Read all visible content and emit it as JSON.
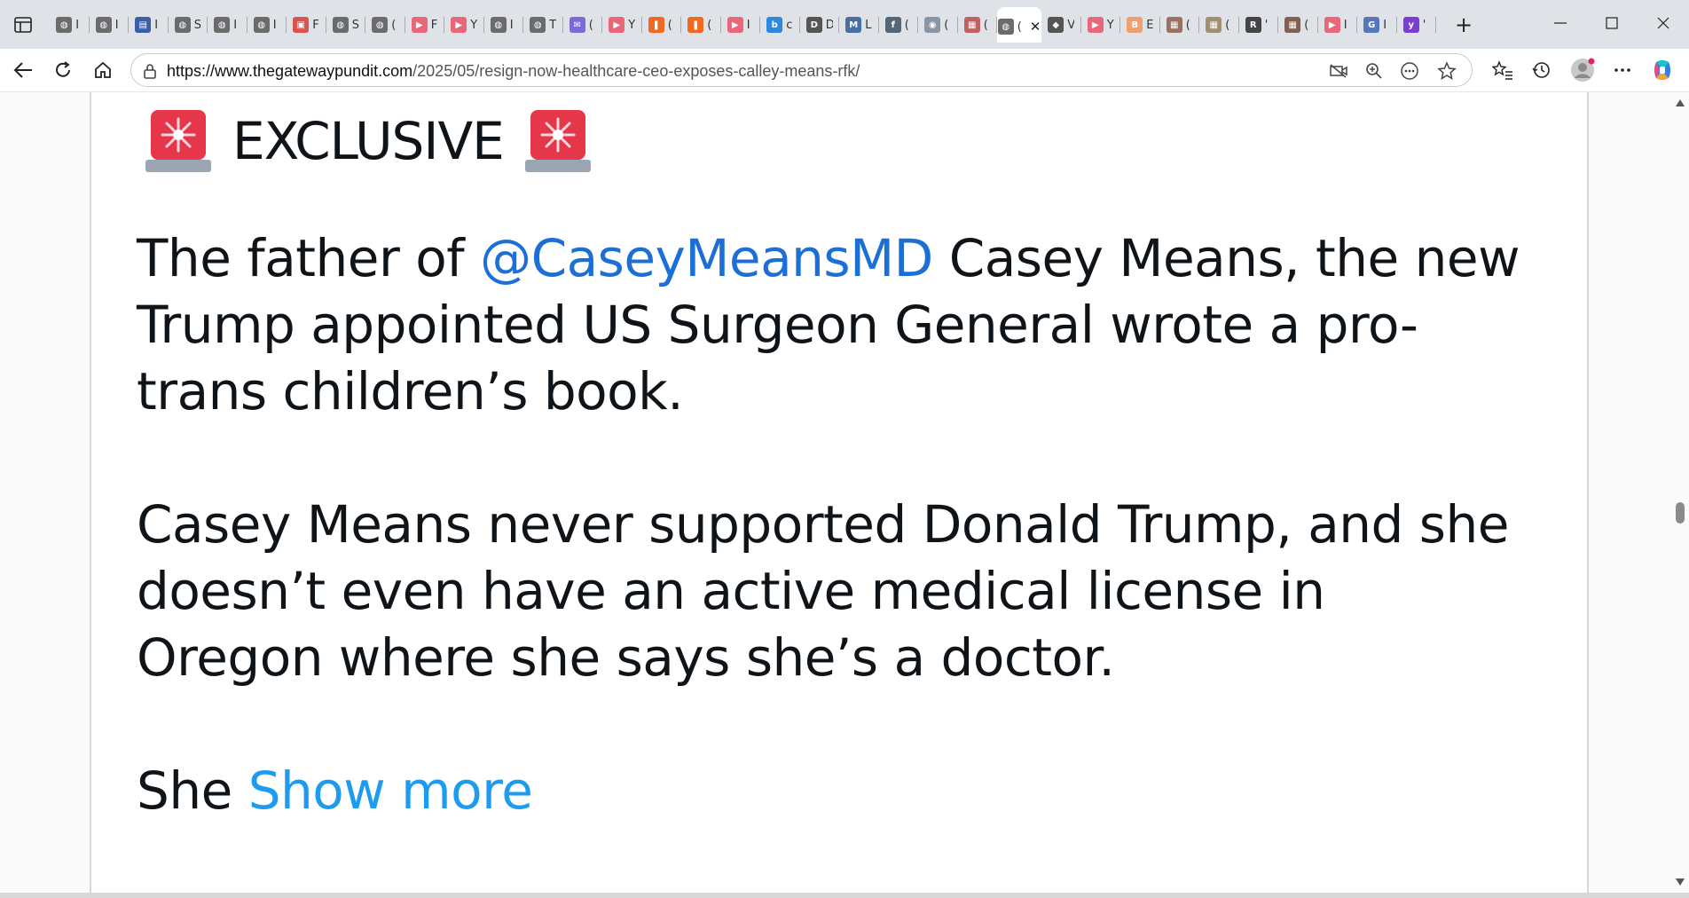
{
  "browser": {
    "tabs": [
      {
        "icon": "globe-icon",
        "color": "#6b6b6b",
        "glyph": "◍",
        "frag": "I"
      },
      {
        "icon": "globe-icon",
        "color": "#6b6b6b",
        "glyph": "◍",
        "frag": "I"
      },
      {
        "icon": "news-icon",
        "color": "#3a5fa8",
        "glyph": "▤",
        "frag": "I"
      },
      {
        "icon": "globe-icon",
        "color": "#6b6b6b",
        "glyph": "◍",
        "frag": "S"
      },
      {
        "icon": "globe-icon",
        "color": "#6b6b6b",
        "glyph": "◍",
        "frag": "I"
      },
      {
        "icon": "globe-icon",
        "color": "#6b6b6b",
        "glyph": "◍",
        "frag": "I"
      },
      {
        "icon": "pdf-icon",
        "color": "#d9534f",
        "glyph": "▣",
        "frag": "F"
      },
      {
        "icon": "globe-icon",
        "color": "#6b6b6b",
        "glyph": "◍",
        "frag": "S"
      },
      {
        "icon": "globe-icon",
        "color": "#6b6b6b",
        "glyph": "◍",
        "frag": "("
      },
      {
        "icon": "youtube-icon",
        "color": "#e8687a",
        "glyph": "▶",
        "frag": "F"
      },
      {
        "icon": "youtube-icon",
        "color": "#e8687a",
        "glyph": "▶",
        "frag": "Y"
      },
      {
        "icon": "globe-icon",
        "color": "#6b6b6b",
        "glyph": "◍",
        "frag": "I"
      },
      {
        "icon": "globe-icon",
        "color": "#6b6b6b",
        "glyph": "◍",
        "frag": "T"
      },
      {
        "icon": "mail-icon",
        "color": "#7d6ad8",
        "glyph": "✉",
        "frag": "("
      },
      {
        "icon": "youtube-icon",
        "color": "#e8687a",
        "glyph": "▶",
        "frag": "Y"
      },
      {
        "icon": "bookmark-icon",
        "color": "#f26722",
        "glyph": "❚",
        "frag": "("
      },
      {
        "icon": "bookmark-icon",
        "color": "#f26722",
        "glyph": "❚",
        "frag": "("
      },
      {
        "icon": "youtube-icon",
        "color": "#e8687a",
        "glyph": "▶",
        "frag": "I"
      },
      {
        "icon": "bing-icon",
        "color": "#2b8ae0",
        "glyph": "b",
        "frag": "c"
      },
      {
        "icon": "dr-icon",
        "color": "#555555",
        "glyph": "D",
        "frag": "D"
      },
      {
        "icon": "mm-icon",
        "color": "#4a6fa5",
        "glyph": "M",
        "frag": "L"
      },
      {
        "icon": "facebook-icon",
        "color": "#556677",
        "glyph": "f",
        "frag": "("
      },
      {
        "icon": "seal-icon",
        "color": "#8896a8",
        "glyph": "◉",
        "frag": "("
      },
      {
        "icon": "thumbnail-icon",
        "color": "#c06060",
        "glyph": "▦",
        "frag": "("
      },
      {
        "icon": "active-tab",
        "color": "#6b6b6b",
        "glyph": "◍",
        "frag": "("
      },
      {
        "icon": "diamond-icon",
        "color": "#555555",
        "glyph": "◆",
        "frag": "V"
      },
      {
        "icon": "youtube-icon",
        "color": "#e8687a",
        "glyph": "▶",
        "frag": "Y"
      },
      {
        "icon": "b-icon",
        "color": "#f0a070",
        "glyph": "B",
        "frag": "E"
      },
      {
        "icon": "thumbnail-icon",
        "color": "#9a7060",
        "glyph": "▦",
        "frag": "("
      },
      {
        "icon": "thumbnail-icon",
        "color": "#a09070",
        "glyph": "▦",
        "frag": "("
      },
      {
        "icon": "r-icon",
        "color": "#444444",
        "glyph": "R",
        "frag": "'"
      },
      {
        "icon": "thumbnail-icon",
        "color": "#806050",
        "glyph": "▦",
        "frag": "("
      },
      {
        "icon": "youtube-icon",
        "color": "#e8687a",
        "glyph": "▶",
        "frag": "I"
      },
      {
        "icon": "gp-icon",
        "color": "#5577bb",
        "glyph": "G",
        "frag": "I"
      },
      {
        "icon": "yahoo-icon",
        "color": "#7b3fd0",
        "glyph": "y",
        "frag": "'"
      }
    ],
    "active_tab_index": 24,
    "url_host": "https://www.thegatewaypundit.com",
    "url_path": "/2025/05/resign-now-healthcare-ceo-exposes-calley-means-rfk/",
    "accent_color": "#1d9bf0"
  },
  "tweet": {
    "exclusive": "EXCLUSIVE",
    "p1_before": "The father of ",
    "p1_mention": "@CaseyMeansMD",
    "p1_after": " Casey Means, the new Trump appointed US Surgeon General wrote a pro-trans children’s  book.",
    "p2": "Casey Means never supported Donald Trump, and she doesn’t even have an active medical license in Oregon where she says she’s a doctor.",
    "p3_before": "She ",
    "show_more": "Show more"
  }
}
